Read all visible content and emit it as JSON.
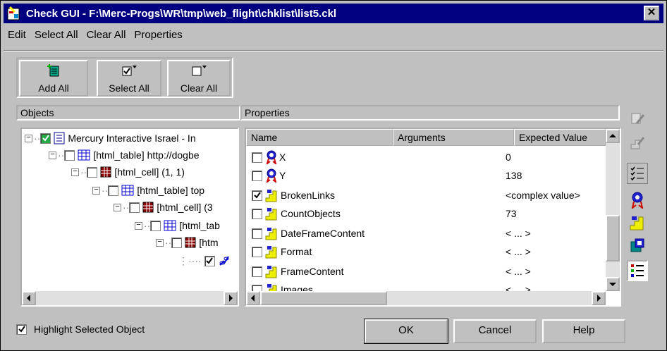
{
  "window": {
    "title": "Check GUI - F:\\Merc-Progs\\WR\\tmp\\web_flight\\chklist\\list5.ckl",
    "close_glyph": "✕"
  },
  "menu": [
    {
      "label": "Edit"
    },
    {
      "label": "Select All"
    },
    {
      "label": "Clear All"
    },
    {
      "label": "Properties"
    }
  ],
  "toolbar": {
    "add_all": "Add All",
    "select_all": "Select All",
    "clear_all": "Clear All"
  },
  "objects_panel": {
    "header": "Objects",
    "tree": [
      {
        "label": "Mercury Interactive Israel - In",
        "checked": true,
        "icon": "document-icon"
      },
      {
        "label": "[html_table] http://dogbe",
        "checked": false,
        "icon": "table-icon"
      },
      {
        "label": "[html_cell] (1, 1)",
        "checked": false,
        "icon": "cell-icon"
      },
      {
        "label": "[html_table] top",
        "checked": false,
        "icon": "table-icon"
      },
      {
        "label": "[html_cell] (3",
        "checked": false,
        "icon": "cell-icon"
      },
      {
        "label": "[html_tab",
        "checked": false,
        "icon": "table-icon"
      },
      {
        "label": "[htm",
        "checked": false,
        "icon": "cell-icon"
      },
      {
        "label": "",
        "checked": true,
        "icon": "link-icon"
      }
    ]
  },
  "properties_panel": {
    "header": "Properties",
    "columns": [
      "Name",
      "Arguments",
      "Expected Value"
    ],
    "rows": [
      {
        "name": "X",
        "checked": false,
        "value": "0",
        "icon": "ribbon-icon"
      },
      {
        "name": "Y",
        "checked": false,
        "value": "138",
        "icon": "ribbon-icon"
      },
      {
        "name": "BrokenLinks",
        "checked": true,
        "value": "<complex value>",
        "icon": "stairs-icon"
      },
      {
        "name": "CountObjects",
        "checked": false,
        "value": "73",
        "icon": "stairs-icon"
      },
      {
        "name": "DateFrameContent",
        "checked": false,
        "value": "< ... >",
        "icon": "stairs-icon"
      },
      {
        "name": "Format",
        "checked": false,
        "value": "< ... >",
        "icon": "stairs-icon"
      },
      {
        "name": "FrameContent",
        "checked": false,
        "value": "< ... >",
        "icon": "stairs-icon"
      },
      {
        "name": "Images",
        "checked": false,
        "value": "< ... >",
        "icon": "stairs-icon"
      }
    ]
  },
  "footer": {
    "highlight_label": "Highlight Selected Object",
    "highlight_checked": true,
    "ok": "OK",
    "cancel": "Cancel",
    "help": "Help"
  },
  "colors": {
    "titlebar": "#000080",
    "face": "#c0c0c0"
  }
}
